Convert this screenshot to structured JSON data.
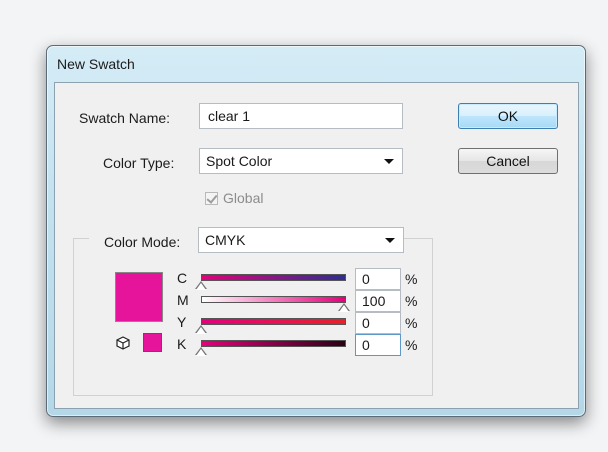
{
  "dialog": {
    "title": "New Swatch",
    "swatch_name_label": "Swatch Name:",
    "swatch_name_value": "clear 1",
    "color_type_label": "Color Type:",
    "color_type_value": "Spot Color",
    "global_label": "Global",
    "global_checked": true,
    "color_mode_label": "Color Mode:",
    "color_mode_value": "CMYK",
    "ok_label": "OK",
    "cancel_label": "Cancel"
  },
  "channels": [
    {
      "label": "C",
      "value": "0",
      "unit": "%",
      "level": 0.0,
      "gradient": [
        "#e4007c",
        "#2e2e8f"
      ]
    },
    {
      "label": "M",
      "value": "100",
      "unit": "%",
      "level": 1.0,
      "gradient": [
        "#ffffff",
        "#e4007c"
      ]
    },
    {
      "label": "Y",
      "value": "0",
      "unit": "%",
      "level": 0.0,
      "gradient": [
        "#e4007c",
        "#e6212b"
      ]
    },
    {
      "label": "K",
      "value": "0",
      "unit": "%",
      "level": 0.0,
      "gradient": [
        "#e4007c",
        "#2b0014"
      ]
    }
  ],
  "colors": {
    "swatch": "#e6139b",
    "accent": "#3c7fb1"
  },
  "icons": {
    "out_of_gamut": "cube-icon"
  }
}
